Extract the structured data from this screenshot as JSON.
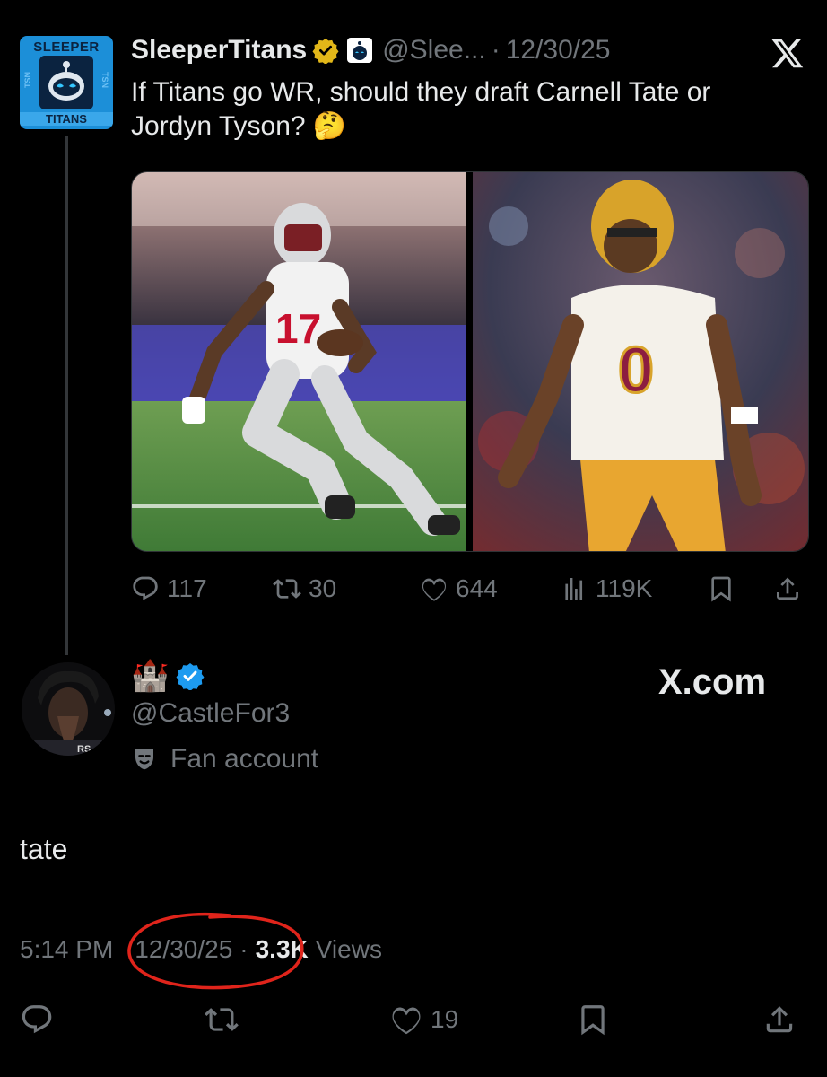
{
  "parent_tweet": {
    "display_name": "SleeperTitans",
    "handle": "@Slee...",
    "date": "12/30/25",
    "text": "If Titans go WR, should they draft Carnell Tate or Jordyn Tyson? 🤔",
    "avatar": {
      "top_text": "SLEEPER",
      "bottom_text": "TITANS",
      "side_text": "TSN"
    },
    "images": [
      {
        "jersey_number": "17"
      },
      {
        "jersey_number": "0"
      }
    ],
    "metrics": {
      "replies": "117",
      "reposts": "30",
      "likes": "644",
      "views": "119K"
    }
  },
  "reply_tweet": {
    "display_name_emoji": "🏰",
    "handle": "@CastleFor3",
    "label": "Fan account",
    "text": "tate",
    "time": "5:14 PM",
    "date": "12/30/25",
    "separator": "·",
    "views_count": "3.3K",
    "views_label": "Views",
    "likes": "19"
  },
  "watermark": "X.com",
  "colors": {
    "background": "#000000",
    "text": "#e7e9ea",
    "muted": "#71767b",
    "verified_blue": "#1d9bf0",
    "verified_gold": "#e2b719",
    "annotation_red": "#e0241b"
  },
  "icons": [
    "reply-icon",
    "repost-icon",
    "like-icon",
    "views-icon",
    "bookmark-icon",
    "share-icon",
    "x-logo-icon",
    "fan-mask-icon"
  ]
}
